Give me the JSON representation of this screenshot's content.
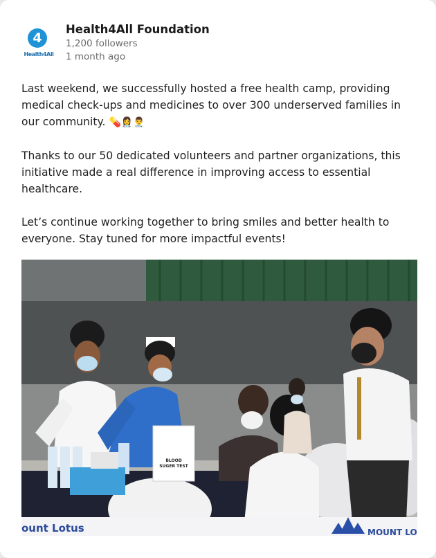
{
  "post": {
    "author": "Health4All Foundation",
    "logo_number": "4",
    "logo_text": "Health4All",
    "followers": "1,200 followers",
    "time": "1 month ago",
    "paragraphs": [
      "Last weekend, we successfully hosted a free health camp, providing medical check-ups and medicines to over 300 underserved families in our community.",
      "Thanks to our 50 dedicated volunteers and partner organizations, this initiative made a real difference in improving access to essential healthcare.",
      "Let’s continue working together to bring smiles and better health to everyone. Stay tuned for more impactful events!"
    ],
    "emojis": "💊👩‍⚕️👨‍⚕️"
  },
  "photo": {
    "banner_left": "ount Lotus",
    "banner_right": "MOUNT LOT",
    "sign_lines": [
      "BLOOD",
      "SUGER TEST"
    ]
  }
}
